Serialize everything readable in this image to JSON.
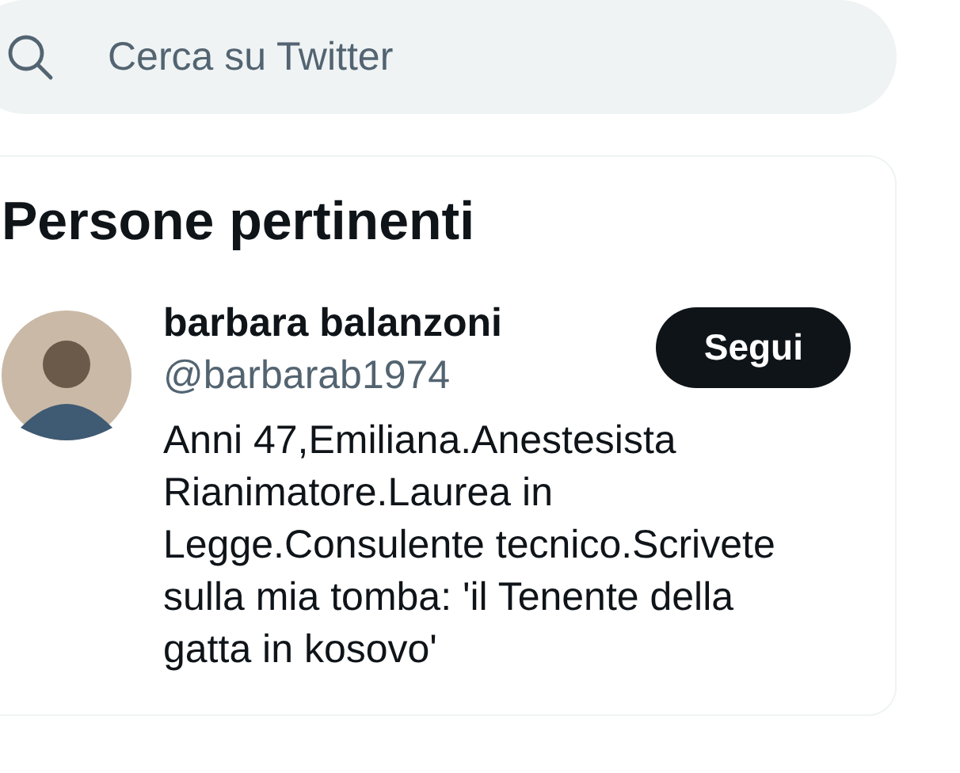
{
  "search": {
    "placeholder": "Cerca su Twitter"
  },
  "relevant_people": {
    "title": "Persone pertinenti",
    "people": [
      {
        "name": "barbara balanzoni",
        "handle": "@barbarab1974",
        "button": "Segui",
        "bio": "Anni 47,Emiliana.Anestesista Rianimatore.Laurea in Legge.Consulente tecnico.Scrivete sulla mia tomba: 'il Tenente della gatta in kosovo'"
      }
    ]
  }
}
